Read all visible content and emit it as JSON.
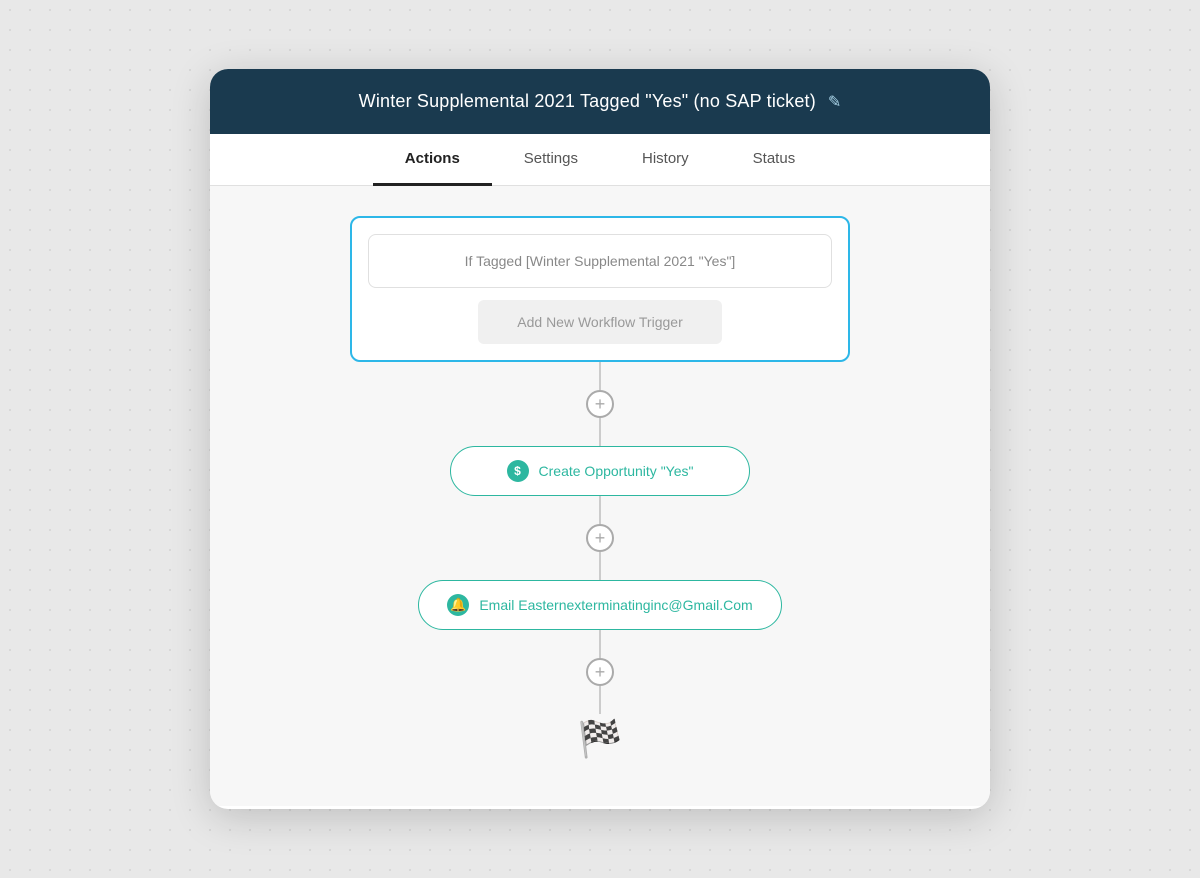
{
  "header": {
    "title": "Winter Supplemental 2021 Tagged \"Yes\" (no SAP ticket)",
    "edit_icon": "✎"
  },
  "tabs": [
    {
      "label": "Actions",
      "active": true
    },
    {
      "label": "Settings",
      "active": false
    },
    {
      "label": "History",
      "active": false
    },
    {
      "label": "Status",
      "active": false
    }
  ],
  "trigger": {
    "condition_label": "If Tagged [Winter Supplemental 2021 \"Yes\"]",
    "add_trigger_label": "Add New Workflow Trigger"
  },
  "actions": [
    {
      "icon_type": "dollar",
      "icon_text": "$",
      "label": "Create Opportunity \"Yes\""
    },
    {
      "icon_type": "bell",
      "icon_text": "🔔",
      "label": "Email Easternexterminatinginc@Gmail.Com"
    }
  ],
  "connectors": {
    "plus_symbol": "+"
  },
  "finish": {
    "icon": "🏁"
  }
}
